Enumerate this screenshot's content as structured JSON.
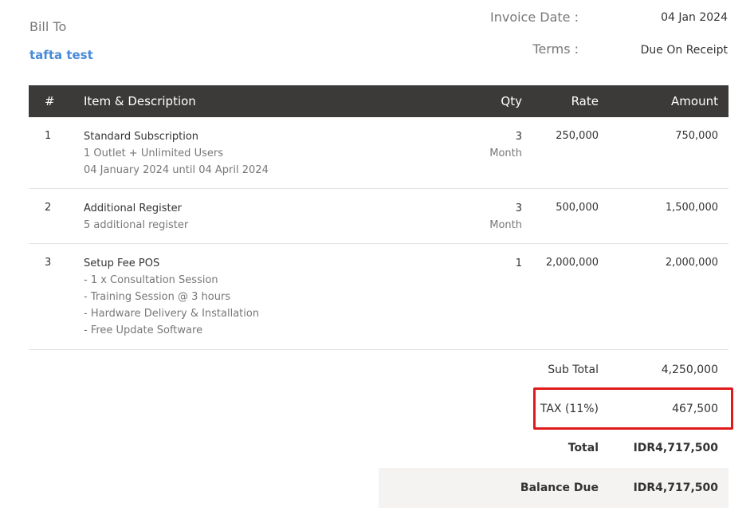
{
  "bill_to": {
    "label": "Bill To",
    "name": "tafta test"
  },
  "meta": {
    "invoice_date_label": "Invoice Date :",
    "invoice_date_value": "04 Jan 2024",
    "terms_label": "Terms :",
    "terms_value": "Due On Receipt"
  },
  "table": {
    "headers": {
      "num": "#",
      "desc": "Item & Description",
      "qty": "Qty",
      "rate": "Rate",
      "amount": "Amount"
    },
    "rows": [
      {
        "num": "1",
        "name": "Standard Subscription",
        "lines": [
          "1 Outlet + Unlimited Users",
          "04 January 2024 until 04 April 2024"
        ],
        "qty": "3",
        "unit": "Month",
        "rate": "250,000",
        "amount": "750,000"
      },
      {
        "num": "2",
        "name": "Additional Register",
        "lines": [
          "5 additional register"
        ],
        "qty": "3",
        "unit": "Month",
        "rate": "500,000",
        "amount": "1,500,000"
      },
      {
        "num": "3",
        "name": "Setup Fee POS",
        "lines": [
          "- 1 x Consultation Session",
          "- Training Session @ 3 hours",
          "- Hardware Delivery & Installation",
          "- Free Update Software"
        ],
        "qty": "1",
        "unit": "",
        "rate": "2,000,000",
        "amount": "2,000,000"
      }
    ]
  },
  "totals": {
    "sub_total_label": "Sub Total",
    "sub_total_value": "4,250,000",
    "tax_label": "TAX (11%)",
    "tax_value": "467,500",
    "total_label": "Total",
    "total_value": "IDR4,717,500",
    "balance_due_label": "Balance Due",
    "balance_due_value": "IDR4,717,500"
  },
  "colors": {
    "header_bg": "#3b3a38",
    "highlight_border": "#e01a1a",
    "link_blue": "#4a8ad8",
    "balance_bg": "#f4f3f1"
  }
}
